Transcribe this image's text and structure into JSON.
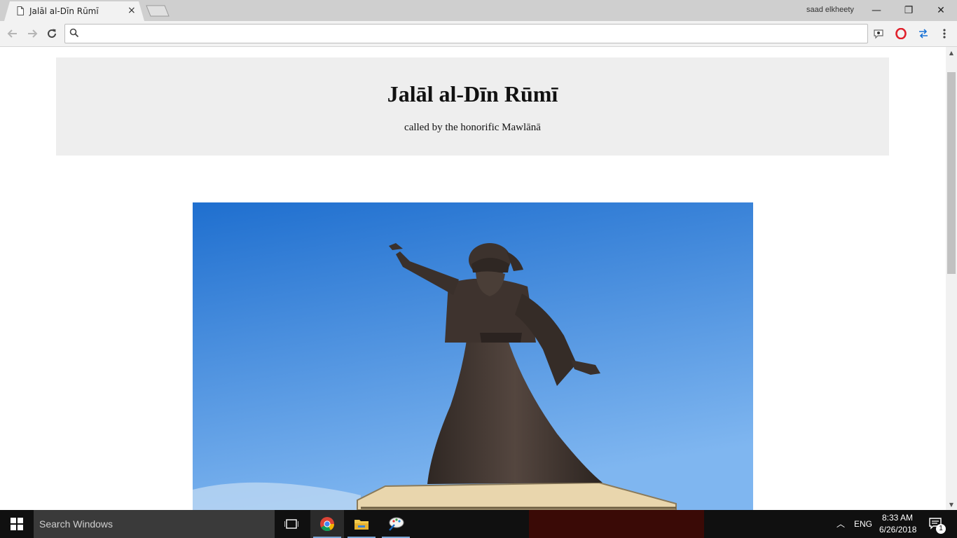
{
  "browser": {
    "tab_title": "Jalāl al-Dīn Rūmī",
    "tab_close": "×",
    "profile_name": "saad elkheety",
    "address_value": "",
    "minimize": "—",
    "maximize": "❐",
    "close": "✕"
  },
  "page": {
    "heading": "Jalāl al-Dīn Rūmī",
    "subheading": "called by the honorific Mawlānā",
    "image_icon": "rumi-statue-photo"
  },
  "taskbar": {
    "search_placeholder": "Search Windows",
    "language": "ENG",
    "time": "8:33 AM",
    "date": "6/26/2018",
    "notification_count": "1"
  },
  "colors": {
    "sky_top": "#1f6fcf",
    "sky_bottom": "#7fb6f0",
    "statue": "#4b3f39",
    "header_bg": "#eeeeee",
    "taskbar_bg": "#101010"
  }
}
